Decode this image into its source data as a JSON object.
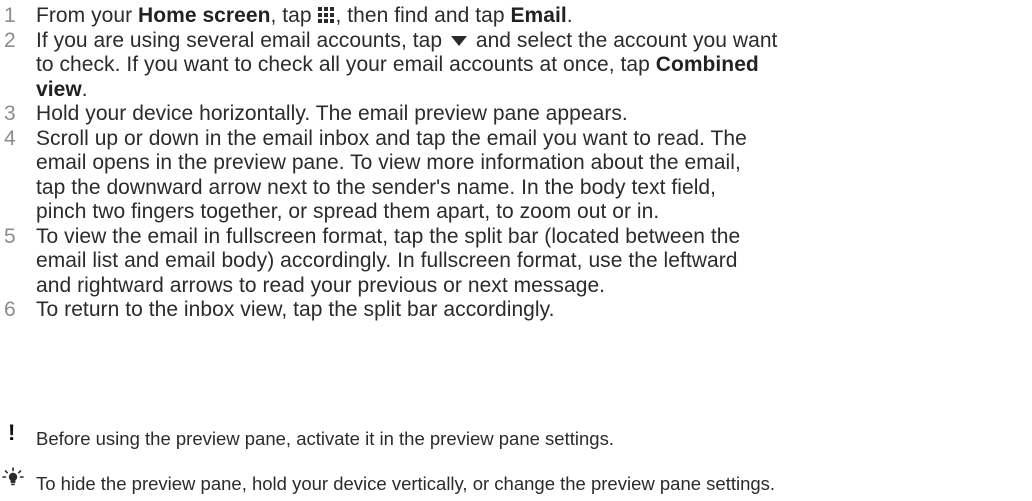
{
  "steps": [
    {
      "number": "1",
      "parts": {
        "a": "From your ",
        "b": "Home screen",
        "c": ", tap ",
        "d": ", then find and tap ",
        "e": "Email",
        "f": "."
      }
    },
    {
      "number": "2",
      "parts": {
        "a": "If you are using several email accounts, tap ",
        "b": " and select the account you want",
        "c": "to check. If you want to check all your email accounts at once, tap ",
        "d": "Combined",
        "e": "view",
        "f": "."
      }
    },
    {
      "number": "3",
      "lines": [
        "Hold your device horizontally. The email preview pane appears."
      ]
    },
    {
      "number": "4",
      "lines": [
        "Scroll up or down in the email inbox and tap the email you want to read. The",
        "email opens in the preview pane. To view more information about the email,",
        "tap the downward arrow next to the sender's name. In the body text field,",
        "pinch two fingers together, or spread them apart, to zoom out or in."
      ]
    },
    {
      "number": "5",
      "lines": [
        "To view the email in fullscreen format, tap the split bar (located between the",
        "email list and email body) accordingly. In fullscreen format, use the leftward",
        "and rightward arrows to read your previous or next message."
      ]
    },
    {
      "number": "6",
      "lines": [
        "To return to the inbox view, tap the split bar accordingly."
      ]
    }
  ],
  "notes": {
    "warning": {
      "icon": "exclamation-icon",
      "text": "Before using the preview pane, activate it in the preview pane settings."
    },
    "tip": {
      "icon": "lightbulb-icon",
      "text": "To hide the preview pane, hold your device vertically, or change the preview pane settings."
    }
  },
  "icons": {
    "apps_grid": "apps-grid-icon",
    "dropdown": "dropdown-triangle-icon"
  },
  "colors": {
    "text": "#2b2b2b",
    "step_number": "#8c8c8c"
  }
}
